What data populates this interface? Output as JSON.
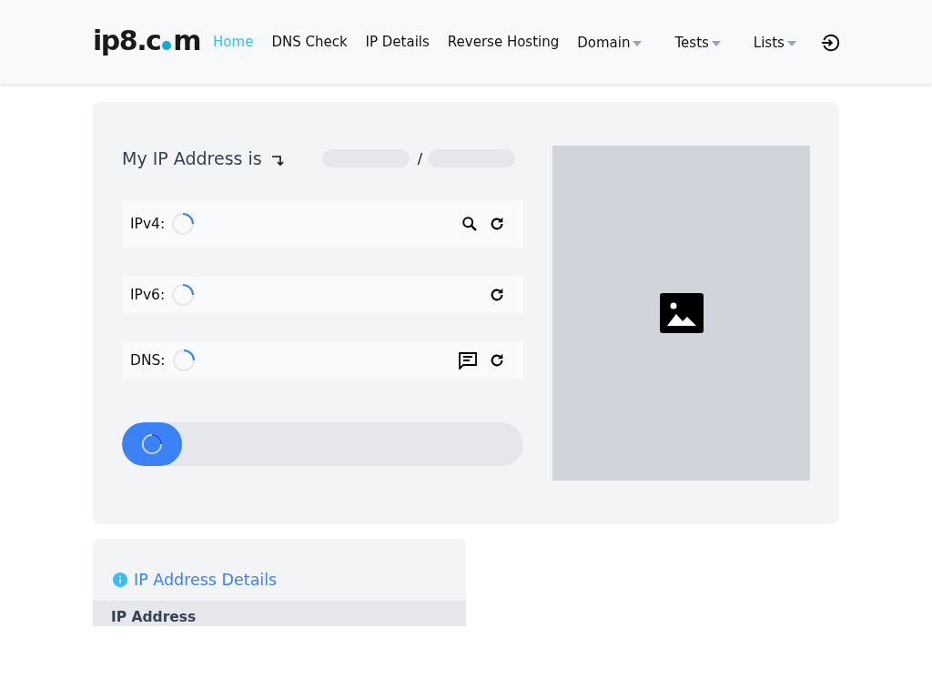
{
  "logo": {
    "before": "ip8.c",
    "after": "m"
  },
  "nav": [
    {
      "label": "Home",
      "selected": true,
      "dropdown": false
    },
    {
      "label": "DNS Check",
      "selected": false,
      "dropdown": false
    },
    {
      "label": "IP Details",
      "selected": false,
      "dropdown": false
    },
    {
      "label": "Reverse Hosting",
      "selected": false,
      "dropdown": false
    },
    {
      "label": "Domain",
      "selected": false,
      "dropdown": true
    },
    {
      "label": "Tests",
      "selected": false,
      "dropdown": true
    },
    {
      "label": "Lists",
      "selected": false,
      "dropdown": true
    }
  ],
  "heading": {
    "text": "My IP Address is",
    "separator": "/"
  },
  "rows": [
    {
      "label": "IPv4:",
      "actions": [
        {
          "kind": "search"
        },
        {
          "kind": "refresh"
        }
      ]
    },
    {
      "label": "IPv6:",
      "actions": [
        {
          "kind": "refresh"
        }
      ]
    },
    {
      "label": "DNS:",
      "actions": [
        {
          "kind": "message"
        },
        {
          "kind": "refresh"
        }
      ]
    }
  ],
  "progress": {
    "level": 0.15
  },
  "details": {
    "title": "IP Address Details",
    "header": "IP Address"
  }
}
